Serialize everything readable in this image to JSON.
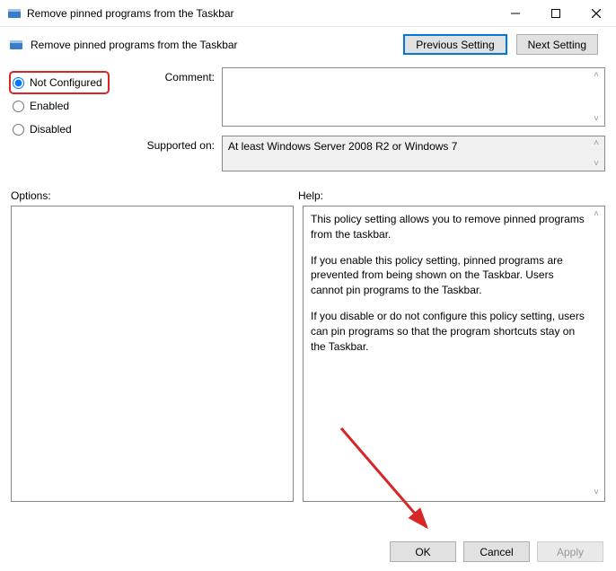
{
  "window": {
    "title": "Remove pinned programs from the Taskbar"
  },
  "subheader": {
    "title": "Remove pinned programs from the Taskbar"
  },
  "nav": {
    "previous": "Previous Setting",
    "next": "Next Setting"
  },
  "radios": {
    "not_configured": "Not Configured",
    "enabled": "Enabled",
    "disabled": "Disabled"
  },
  "fields": {
    "comment_label": "Comment:",
    "comment_value": "",
    "supported_label": "Supported on:",
    "supported_value": "At least Windows Server 2008 R2 or Windows 7"
  },
  "panels": {
    "options_label": "Options:",
    "help_label": "Help:"
  },
  "help": {
    "p1": "This policy setting allows you to remove pinned programs from the taskbar.",
    "p2": "If you enable this policy setting, pinned programs are prevented from being shown on the Taskbar. Users cannot pin programs to the Taskbar.",
    "p3": "If you disable or do not configure this policy setting, users can pin programs so that the program shortcuts stay on the Taskbar."
  },
  "footer": {
    "ok": "OK",
    "cancel": "Cancel",
    "apply": "Apply"
  }
}
